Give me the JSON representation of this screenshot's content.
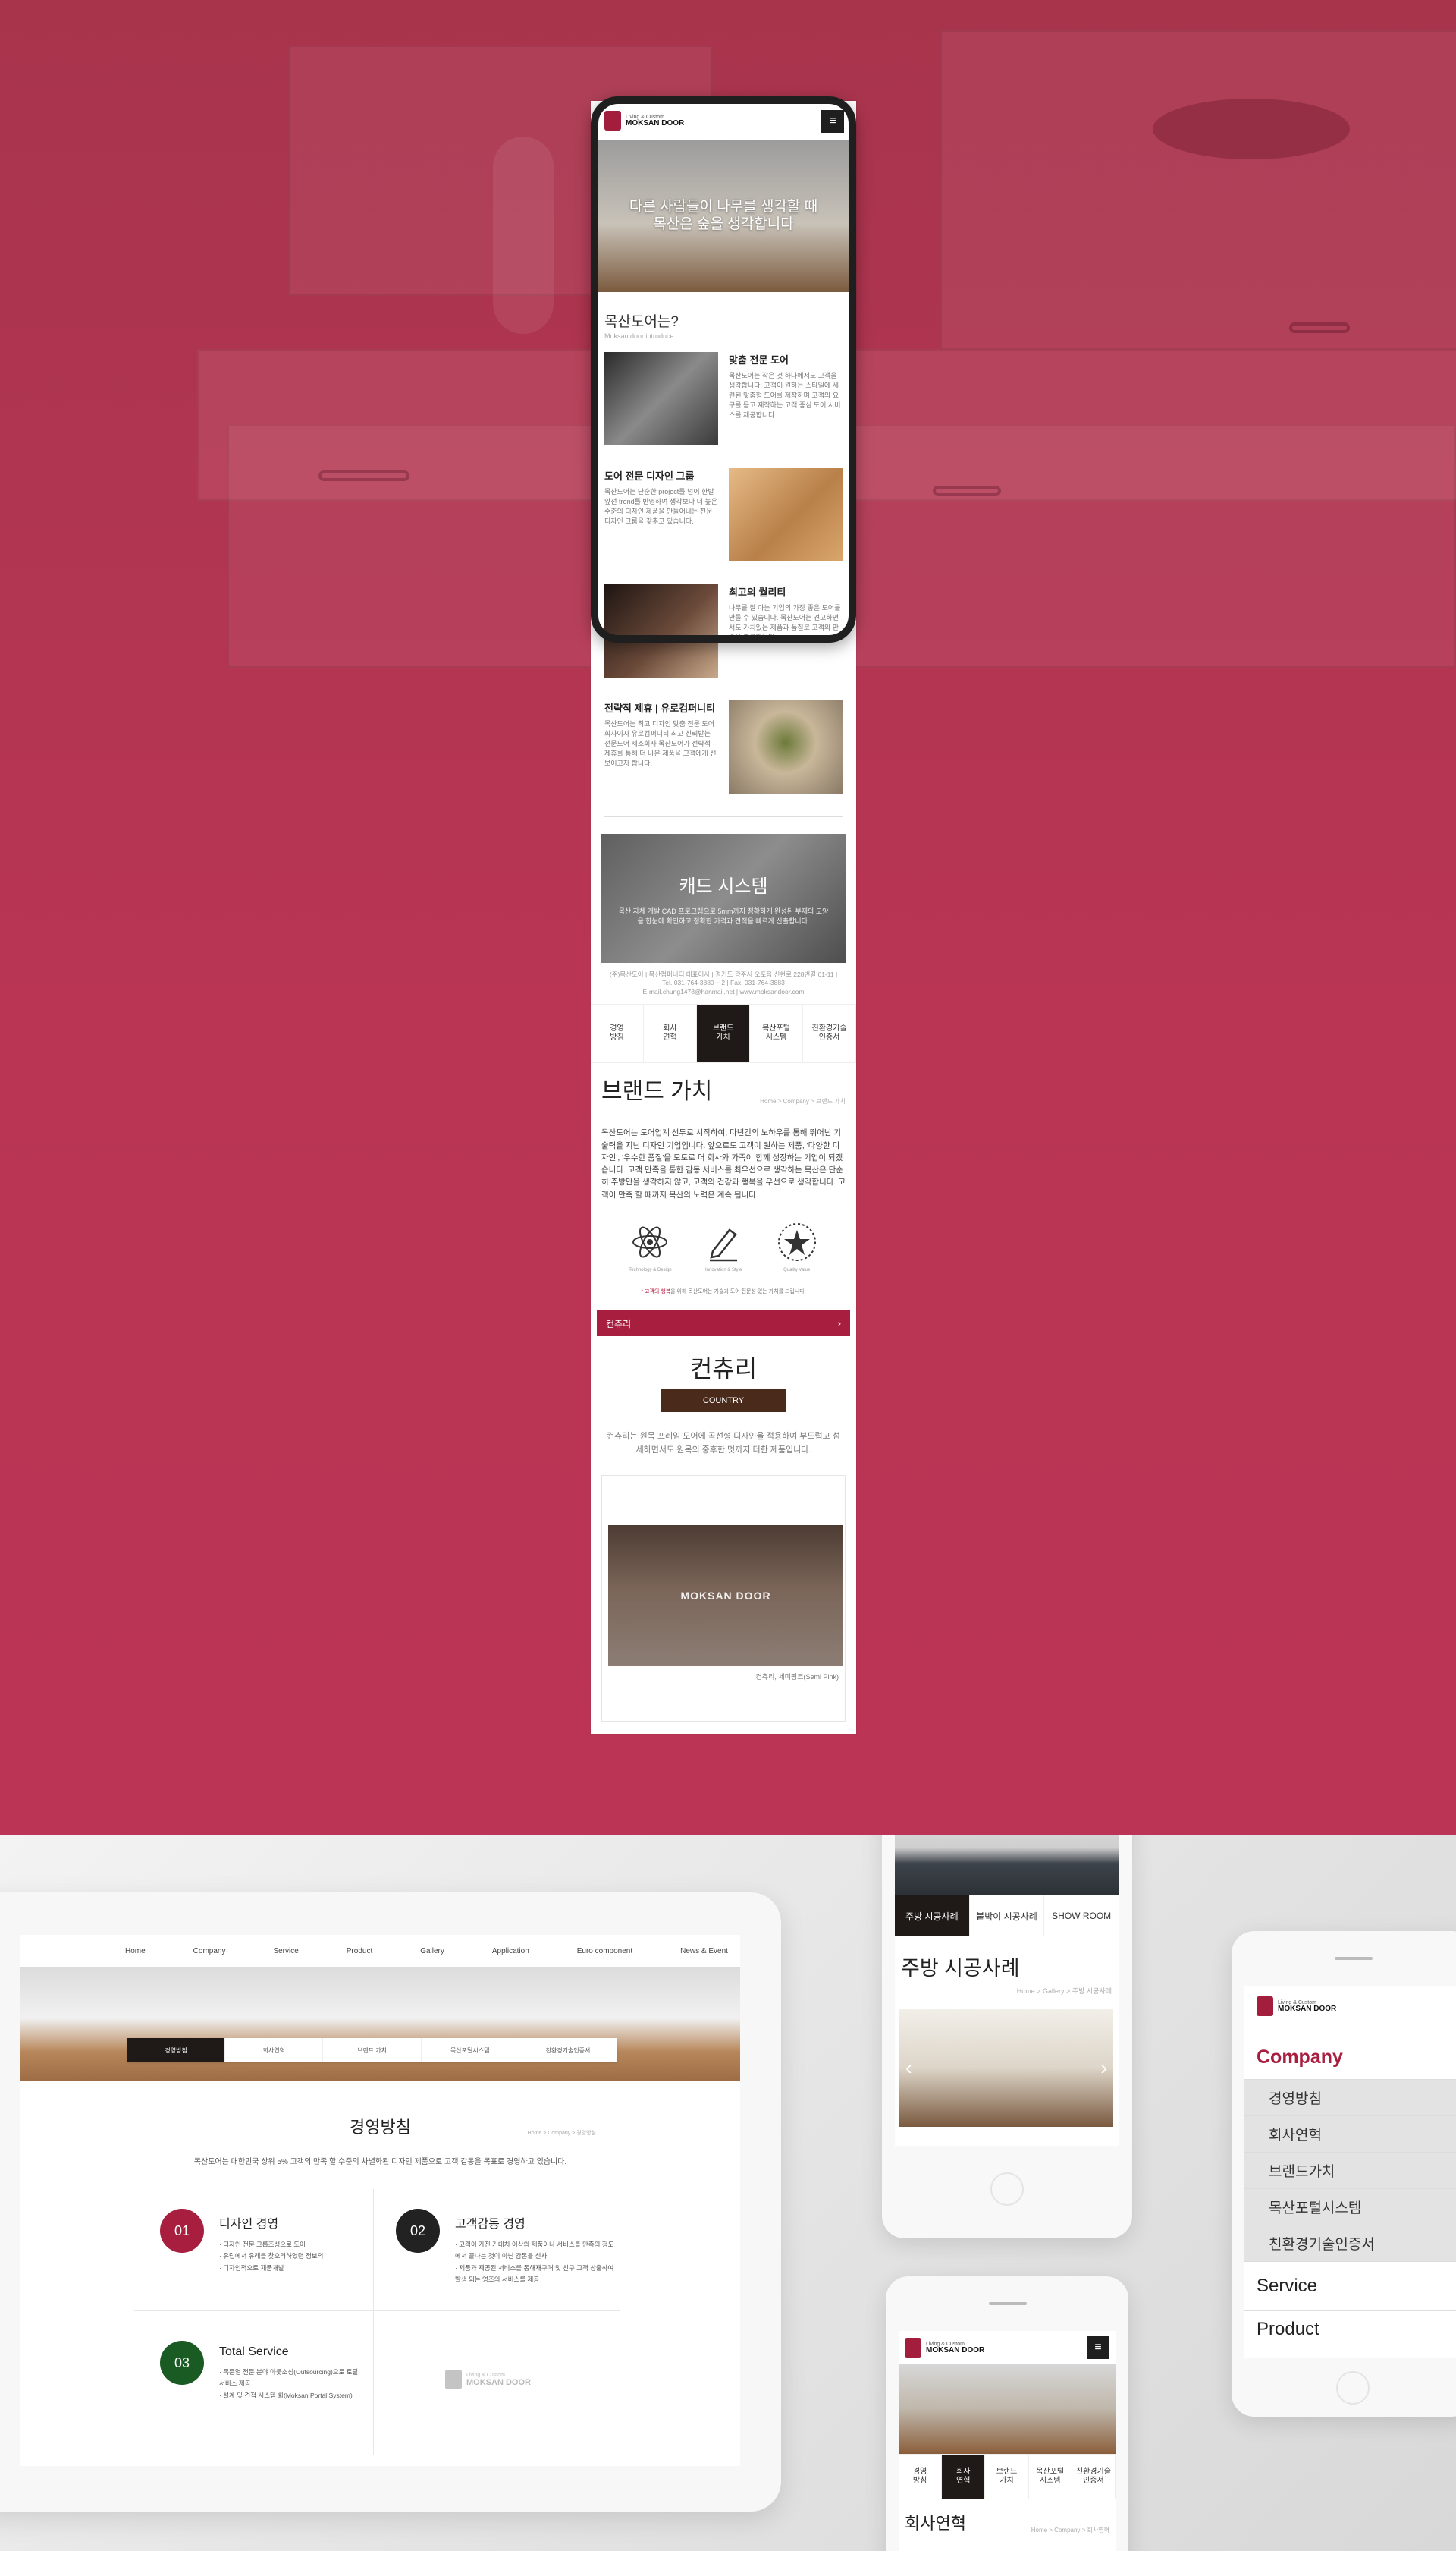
{
  "colors": {
    "brand_red": "#a81e3f",
    "dark_brown": "#1f1a17",
    "country_brown": "#4a2a1a",
    "circle_red": "#a81e3f",
    "circle_dark": "#222222",
    "circle_green": "#1a5a23"
  },
  "logo": {
    "small": "Living & Custom",
    "big": "MOKSAN DOOR"
  },
  "mobile": {
    "hero_text_line1": "다른 사람들이 나무를 생각할 때",
    "hero_text_line2": "목산은 숲을 생각합니다",
    "intro_title": "목산도어는?",
    "intro_sub": "Moksan door introduce",
    "features": [
      {
        "title": "맞춤 전문 도어",
        "desc": "목산도어는 작은 것 하나에서도 고객을 생각합니다. 고객이 원하는 스타일에 세련된 맞춤형 도어를 제작하며 고객의 요구를 듣고 제작하는 고객 중심 도어 서비스를 제공합니다."
      },
      {
        "title": "도어 전문 디자인 그룹",
        "desc": "목산도어는 단순한 project를 넘어 한발 앞선 trend를 반영하여 생각보다 더 높은 수준의 디자인 제품을 만들어내는 전문 디자인 그룹을 갖추고 있습니다."
      },
      {
        "title": "최고의 퀄리티",
        "desc": "나무를 잘 아는 기업의 가장 좋은 도어를 만들 수 있습니다. 목산도어는 견고하면서도 가치있는 제품과 품질로 고객의 만족을 추구합니다."
      },
      {
        "title": "전략적 제휴 | 유로컴퍼니티",
        "desc": "목산도어는 최고 디자인 맞춤 전문 도어 회사이자 유로컴퍼니티 최고 신뢰받는 전문도어 제조회사 목산도어가 전략적 제휴를 통해 더 나은 제품을 고객에게 선보이고자 합니다."
      }
    ],
    "cad_title": "캐드 시스템",
    "cad_desc": "목산 자체 개발 CAD 프로그램으로 5mm까지 정확하게 완성된 부재의 모양을 한눈에 확인하고 정확한 가격과 견적을 빠르게 산출합니다.",
    "footer_line1": "(주)목산도어 | 목산컴퍼니티 대표이사 | 경기도 광주시 오포읍 신현로 228번길 61-11 | Tel. 031-764-3880 ~ 2 | Fax. 031-764-3883",
    "footer_line2": "E-mail.chung1478@hanmail.net | www.moksandoor.com",
    "tabs": [
      "경영\n방침",
      "회사\n연혁",
      "브랜드\n가치",
      "목산포털\n시스템",
      "친환경기술\n인증서"
    ],
    "active_tab": 2,
    "page_title": "브랜드 가치",
    "breadcrumb": "Home > Company > 브랜드 가치",
    "body_text": "목산도어는 도어업계 선두로 시작하여, 다년간의 노하우를 통해 뛰어난 기술력을 지닌 디자인 기업입니다. 앞으로도 고객이 원하는 제품, '다양한 디자인', '우수한 품질'을 모토로 더 회사와 가족이 함께 성장하는 기업이 되겠습니다. 고객 만족을 통한 감동 서비스를 최우선으로 생각하는 목산은 단순히 주방만을 생각하지 않고, 고객의 건강과 행복을 우선으로 생각합니다. 고객이 만족 할 때까지 목산의 노력은 계속 됩니다.",
    "icon_captions": [
      "Technology & Design",
      "Innovation & Style",
      "Quality Value"
    ],
    "note_prefix": "* 고객의 행복",
    "note_text": "을 위해 목산도어는 기술과 도어 전문성 있는 가치",
    "note_suffix": "를 드립니다.",
    "country_bar_label": "컨츄리",
    "country_title": "컨츄리",
    "country_badge": "COUNTRY",
    "country_desc": "컨츄리는 원목 프레임 도어에 곡선형 디자인을 적용하여 부드럽고 섬세하면서도 원목의 중후한 멋까지 더한 제품입니다.",
    "watermark": "MOKSAN DOOR",
    "country_caption": "컨츄리, 세미핑크(Semi Pink)"
  },
  "tablet": {
    "nav": [
      "Home",
      "Company",
      "Service",
      "Product",
      "Gallery",
      "Application",
      "Euro component",
      "News & Event"
    ],
    "subnav": [
      "경영방침",
      "회사연혁",
      "브랜드 가치",
      "목산포털시스템",
      "친환경기술인증서"
    ],
    "active_sub": 0,
    "title": "경영방침",
    "breadcrumb": "Home > Company > 경영방침",
    "intro": "목산도어는 대한민국 상위 5% 고객의 만족 할 수준의 차별화된 디자인 제품으로 고객 감동을 목표로 경영하고 있습니다.",
    "items": [
      {
        "num": "01",
        "title": "디자인 경영",
        "lines": [
          "· 디자인 전문 그룹조성으로 도어",
          "· 유럽에서 유래를 찾으러하였던 정보의",
          "· 디자인적으로 재품개발"
        ]
      },
      {
        "num": "02",
        "title": "고객감동 경영",
        "lines": [
          "· 고객이 가진 기대치 이상의 제품이나 서비스를 만족의 정도",
          "  에서 끝나는 것이 아닌 감동을 선사",
          "· 제품과 제공된 서비스를 통해재구매 및 친구 고객 창출하여",
          "  발생 되는 영조의 서비스를 제공"
        ]
      },
      {
        "num": "03",
        "title": "Total  Service",
        "lines": [
          "· 목문열 전문 분야 아웃소싱(Outsourcing)으로 토탈",
          "  서비스 제공",
          "· 설계 및 견적 시스템 화(Moksan Portal System)"
        ]
      }
    ]
  },
  "phone_gallery": {
    "tabs": [
      "주방 시공사례",
      "붙박이 시공사례",
      "SHOW ROOM"
    ],
    "active_tab": 0,
    "title": "주방 시공사례",
    "breadcrumb": "Home > Gallery > 주방 시공사례"
  },
  "phone_menu": {
    "section": "Company",
    "items": [
      "경영방침",
      "회사연혁",
      "브랜드가치",
      "목산포털시스템",
      "친환경기술인증서"
    ],
    "service": "Service",
    "product": "Product"
  },
  "phone_history": {
    "tabs": [
      "경영\n방침",
      "회사\n연혁",
      "브랜드\n가치",
      "목산포털\n시스템",
      "친환경기술\n인증서"
    ],
    "active_tab": 1,
    "title": "회사연혁",
    "breadcrumb": "Home > Company > 회사연혁"
  }
}
